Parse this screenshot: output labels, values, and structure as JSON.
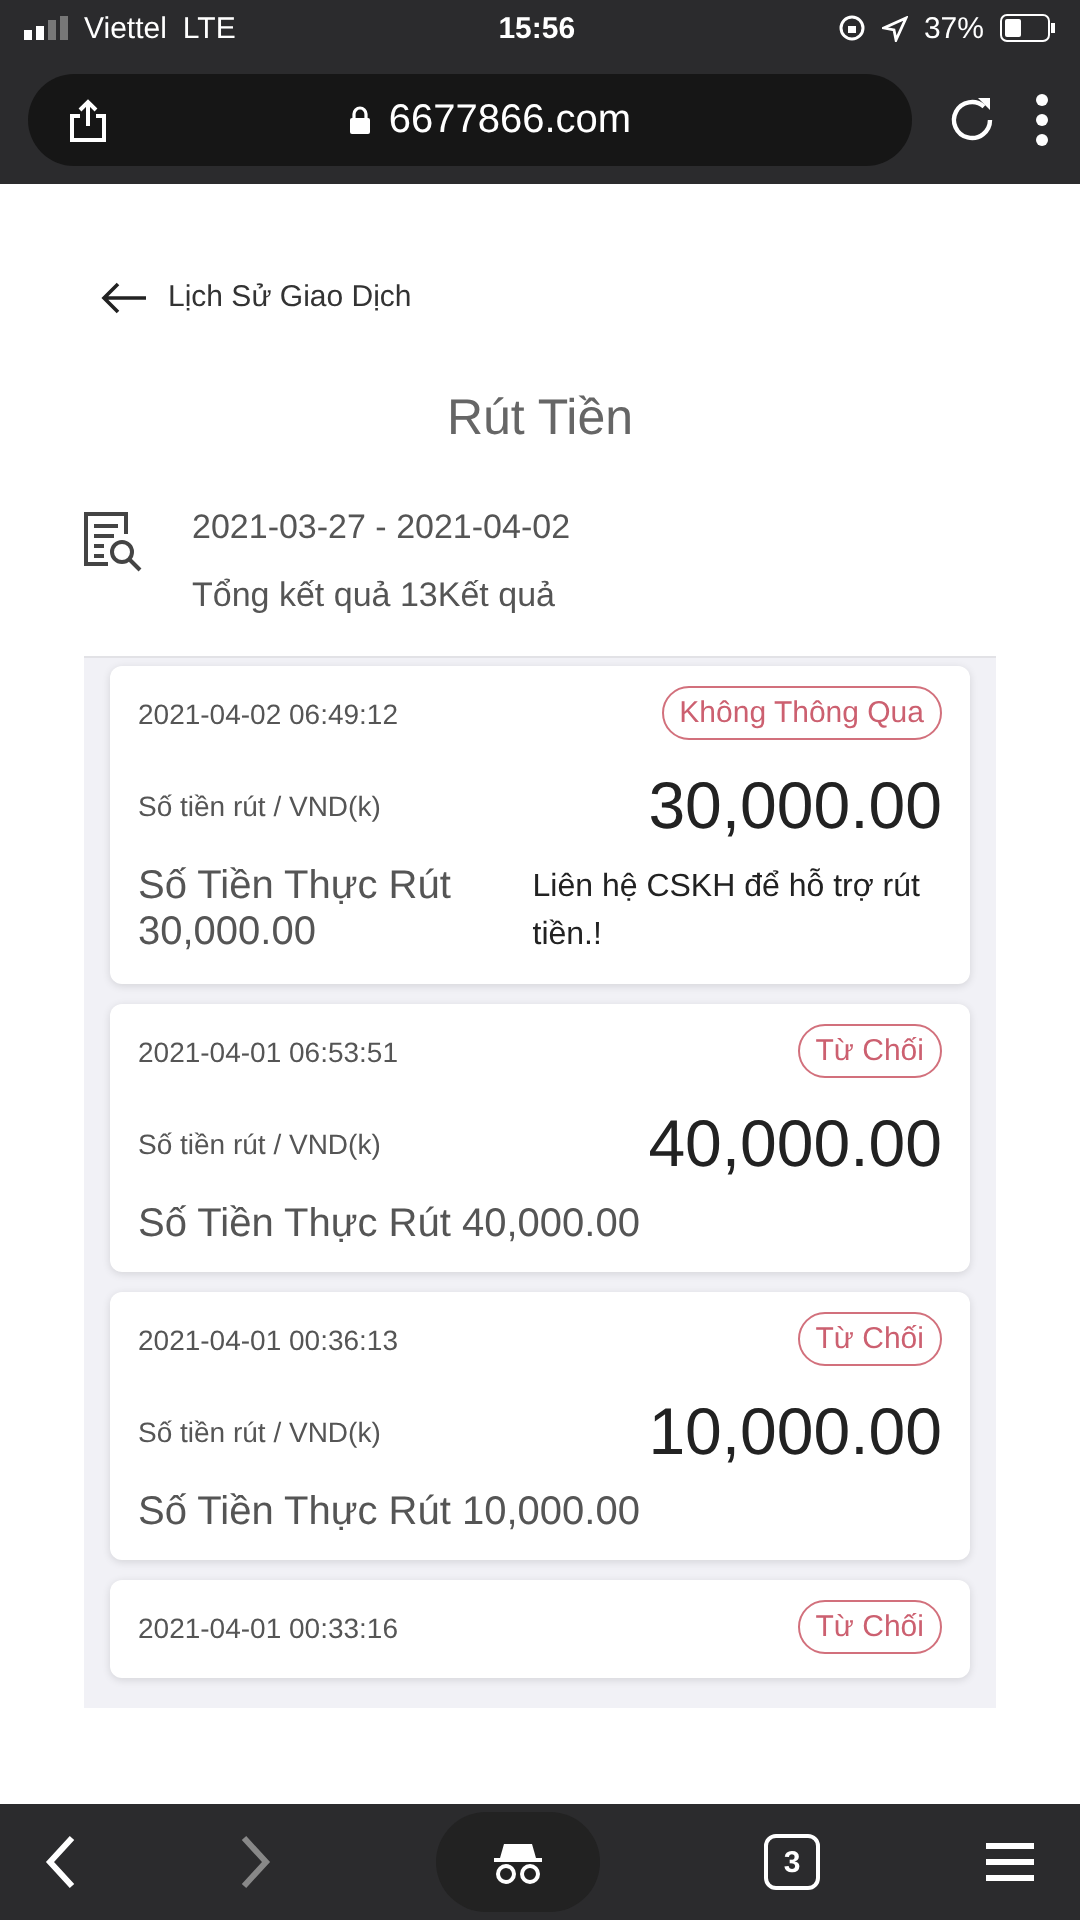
{
  "status_bar": {
    "carrier": "Viettel",
    "network": "LTE",
    "time": "15:56",
    "battery": "37%"
  },
  "browser": {
    "url": "6677866.com",
    "tab_count": "3"
  },
  "page": {
    "back_label": "Lịch Sử Giao Dịch",
    "title": "Rút Tiền",
    "date_range": "2021-03-27 - 2021-04-02",
    "total": "Tổng kết quả 13Kết quả"
  },
  "records": [
    {
      "datetime": "2021-04-02 06:49:12",
      "status": "Không Thông Qua",
      "label": "Số tiền rút / VND(k)",
      "amount": "30,000.00",
      "actual": "Số Tiền Thực Rút 30,000.00",
      "note": "Liên hệ CSKH để hỗ trợ rút tiền.!"
    },
    {
      "datetime": "2021-04-01 06:53:51",
      "status": "Từ Chối",
      "label": "Số tiền rút / VND(k)",
      "amount": "40,000.00",
      "actual": "Số Tiền Thực Rút 40,000.00"
    },
    {
      "datetime": "2021-04-01 00:36:13",
      "status": "Từ Chối",
      "label": "Số tiền rút / VND(k)",
      "amount": "10,000.00",
      "actual": "Số Tiền Thực Rút 10,000.00"
    },
    {
      "datetime": "2021-04-01 00:33:16",
      "status": "Từ Chối"
    }
  ]
}
